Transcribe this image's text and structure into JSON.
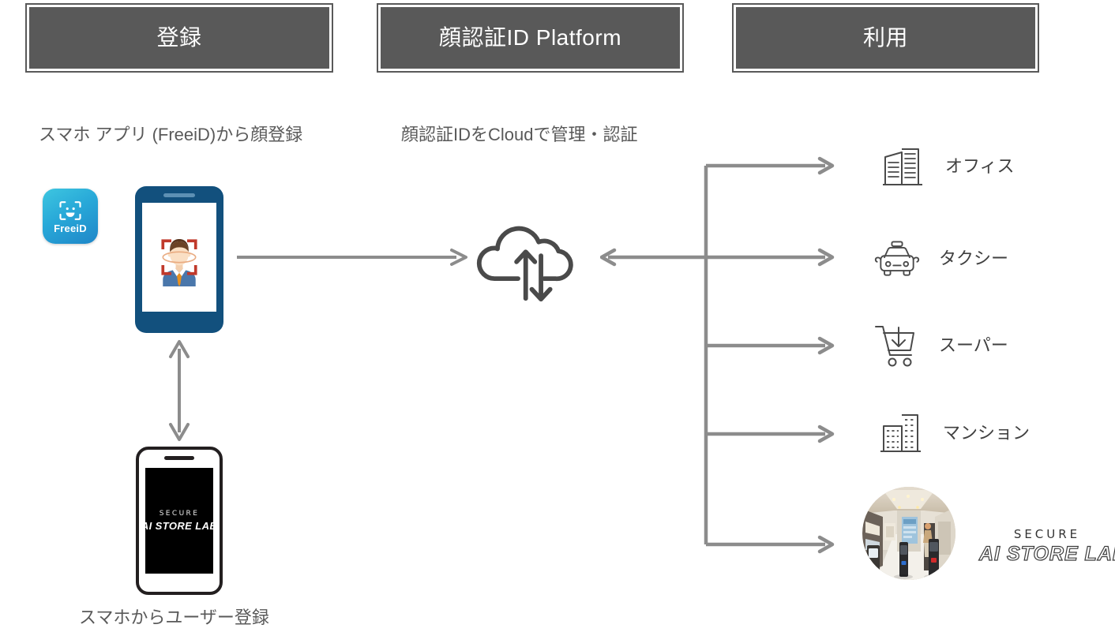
{
  "headers": [
    {
      "id": "register",
      "label": "登録"
    },
    {
      "id": "platform",
      "label": "顔認証ID Platform"
    },
    {
      "id": "use",
      "label": "利用"
    }
  ],
  "captions": {
    "register": "スマホ アプリ (FreeiD)から顔登録",
    "cloud": "顔認証IDをCloudで管理・認証",
    "bottom": "スマホからユーザー登録"
  },
  "app_icon": {
    "name": "FreeiD",
    "icon": "face-scan-icon",
    "color_start": "#3ec6e0",
    "color_end": "#1f86c8"
  },
  "phone_face": {
    "icon": "face-recognition-icon",
    "body_color": "#12507d",
    "bracket_color": "#c0392b"
  },
  "phone_lab": {
    "brand": "SECURE",
    "product": "AI STORE LAB",
    "body_color": "#ffffff",
    "bezel_color": "#231f20",
    "screen_color": "#000000"
  },
  "cloud": {
    "icon": "cloud-sync-icon",
    "color": "#4a4a4a"
  },
  "connectors": {
    "color": "#8c8c8c",
    "phone_to_cloud": "arrow-right",
    "phone_to_phone": "arrow-up-down",
    "cloud_to_trunk": "arrow-left",
    "branch_count": 5
  },
  "use_cases": [
    {
      "id": "office",
      "label": "オフィス",
      "icon": "office-building-icon"
    },
    {
      "id": "taxi",
      "label": "タクシー",
      "icon": "taxi-icon"
    },
    {
      "id": "super",
      "label": "スーパー",
      "icon": "shopping-cart-icon"
    },
    {
      "id": "mansion",
      "label": "マンション",
      "icon": "apartment-building-icon"
    }
  ],
  "store": {
    "photo_alt": "store-interior-photo",
    "brand": "SECURE",
    "product": "AI STORE LAB"
  },
  "colors": {
    "header_fill": "#595959",
    "header_text": "#ffffff",
    "body_text": "#595959",
    "label_text": "#404040",
    "line": "#8c8c8c",
    "icon_stroke": "#4a4a4a",
    "background": "#ffffff"
  }
}
